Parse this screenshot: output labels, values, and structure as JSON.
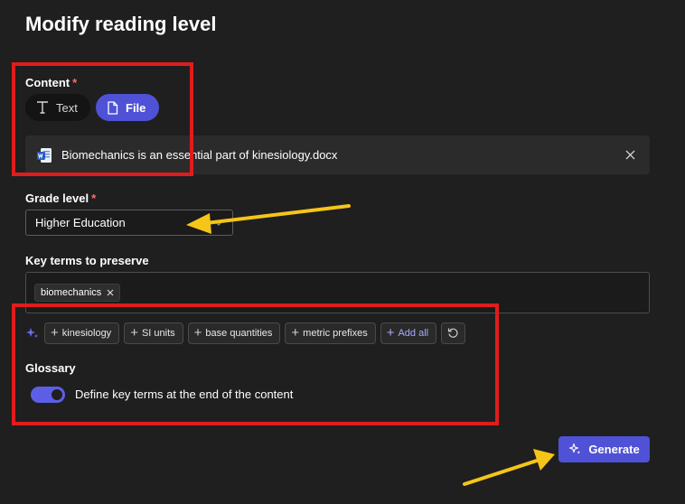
{
  "page": {
    "title": "Modify reading level"
  },
  "content": {
    "label": "Content",
    "required_mark": "*",
    "text_button": "Text",
    "file_button": "File",
    "file_name": "Biomechanics is an essential part of kinesiology.docx",
    "file_icon": "word-doc-icon"
  },
  "grade": {
    "label": "Grade level",
    "required_mark": "*",
    "value": "Higher Education"
  },
  "key_terms": {
    "label": "Key terms to preserve",
    "chips": [
      "biomechanics"
    ],
    "suggestions": [
      "kinesiology",
      "SI units",
      "base quantities",
      "metric prefixes"
    ],
    "add_all": "Add all"
  },
  "glossary": {
    "label": "Glossary",
    "toggle_on": true,
    "toggle_label": "Define key terms at the end of the content"
  },
  "actions": {
    "generate": "Generate"
  },
  "colors": {
    "accent": "#4f52d6",
    "highlight_box": "#e11c1c",
    "annotation_arrow": "#f5c518"
  }
}
